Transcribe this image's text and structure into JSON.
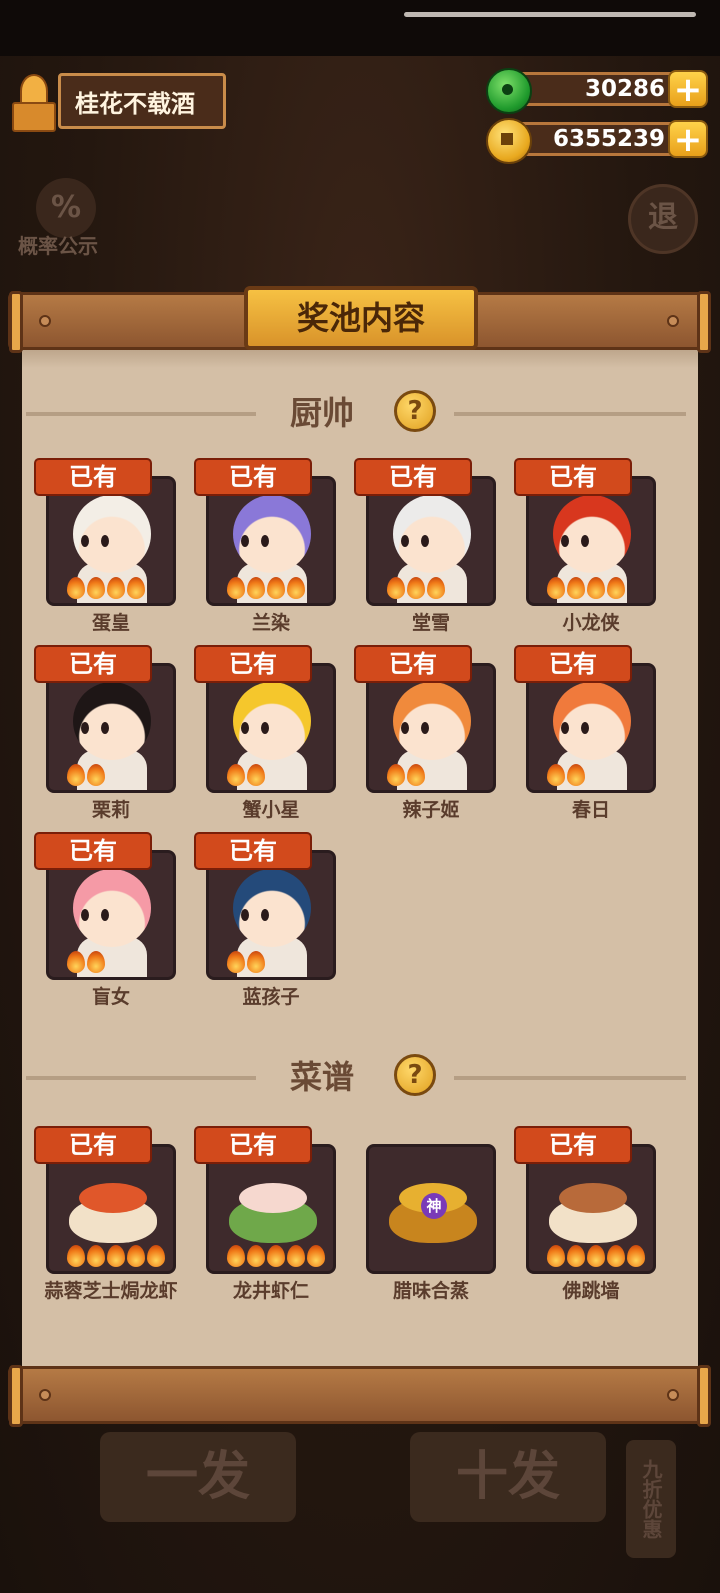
{
  "player": {
    "name": "桂花不载酒"
  },
  "currency": {
    "jade": "30286",
    "gold": "6355239",
    "plus": "+"
  },
  "background": {
    "prob_label": "概率公示",
    "prob_icon": "%",
    "exit_icon": "退",
    "single_draw": "一发",
    "ten_draw": "十发",
    "discount": "九折优惠"
  },
  "panel": {
    "title": "奖池内容"
  },
  "chefs": {
    "heading": "厨帅",
    "help": "?",
    "items": [
      {
        "name": "蛋皇",
        "badge": "已有",
        "flames": 4,
        "hair": "#f3eee6",
        "skin": "#fbe3cf"
      },
      {
        "name": "兰染",
        "badge": "已有",
        "flames": 4,
        "hair": "#8a78d8",
        "skin": "#fbe3cf"
      },
      {
        "name": "堂雪",
        "badge": "已有",
        "flames": 3,
        "hair": "#ecebea",
        "skin": "#fbe3cf"
      },
      {
        "name": "小龙侠",
        "badge": "已有",
        "flames": 4,
        "hair": "#d8371e",
        "skin": "#fbe3cf"
      },
      {
        "name": "栗莉",
        "badge": "已有",
        "flames": 2,
        "hair": "#1e1616",
        "skin": "#fbe3cf"
      },
      {
        "name": "蟹小星",
        "badge": "已有",
        "flames": 2,
        "hair": "#f5c72c",
        "skin": "#fbe3cf"
      },
      {
        "name": "辣子姬",
        "badge": "已有",
        "flames": 2,
        "hair": "#f08a3c",
        "skin": "#fbe3cf"
      },
      {
        "name": "春日",
        "badge": "已有",
        "flames": 2,
        "hair": "#f07a3c",
        "skin": "#fbe3cf"
      },
      {
        "name": "盲女",
        "badge": "已有",
        "flames": 2,
        "hair": "#f59aa6",
        "skin": "#fbe3cf"
      },
      {
        "name": "蓝孩子",
        "badge": "已有",
        "flames": 2,
        "hair": "#244a7a",
        "skin": "#fbe3cf"
      }
    ]
  },
  "recipes": {
    "heading": "菜谱",
    "help": "?",
    "items": [
      {
        "name": "蒜蓉芝士焗龙虾",
        "badge": "已有",
        "flames": 5,
        "food": "#e0572a",
        "bowl": "#f2e1c8"
      },
      {
        "name": "龙井虾仁",
        "badge": "已有",
        "flames": 5,
        "food": "#f6d8cf",
        "bowl": "#6fa84a"
      },
      {
        "name": "腊味合蒸",
        "badge": "",
        "flames": 0,
        "food": "#e7b030",
        "bowl": "#c8851e",
        "god_badge": "神"
      },
      {
        "name": "佛跳墙",
        "badge": "已有",
        "flames": 5,
        "food": "#b86a3a",
        "bowl": "#f2e1c8"
      }
    ]
  }
}
